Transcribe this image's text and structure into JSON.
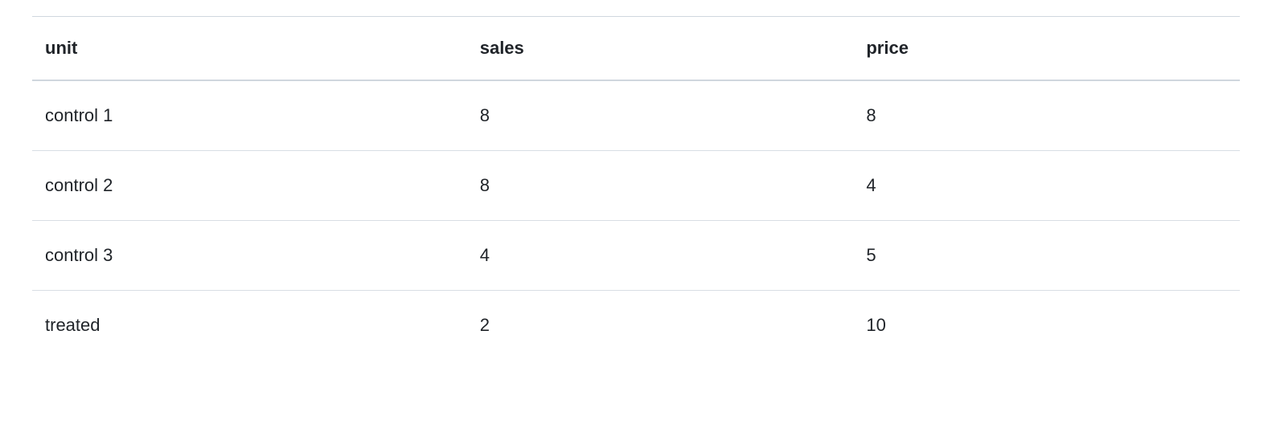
{
  "table": {
    "headers": {
      "unit": "unit",
      "sales": "sales",
      "price": "price"
    },
    "rows": [
      {
        "unit": "control 1",
        "sales": "8",
        "price": "8"
      },
      {
        "unit": "control 2",
        "sales": "8",
        "price": "4"
      },
      {
        "unit": "control 3",
        "sales": "4",
        "price": "5"
      },
      {
        "unit": "treated",
        "sales": "2",
        "price": "10"
      }
    ]
  },
  "chart_data": {
    "type": "table",
    "columns": [
      "unit",
      "sales",
      "price"
    ],
    "data": [
      {
        "unit": "control 1",
        "sales": 8,
        "price": 8
      },
      {
        "unit": "control 2",
        "sales": 8,
        "price": 4
      },
      {
        "unit": "control 3",
        "sales": 4,
        "price": 5
      },
      {
        "unit": "treated",
        "sales": 2,
        "price": 10
      }
    ]
  }
}
